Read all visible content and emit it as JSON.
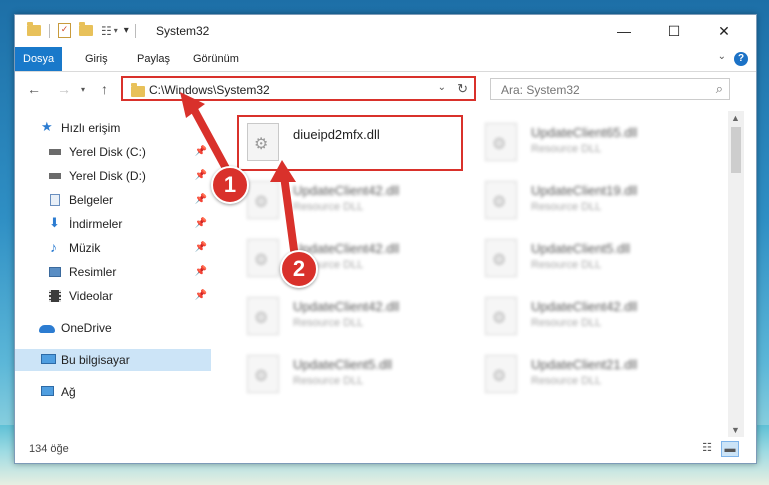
{
  "window": {
    "title": "System32",
    "minimize": "—",
    "maximize": "☐",
    "close": "✕"
  },
  "ribbon": {
    "tabs": [
      "Dosya",
      "Giriş",
      "Paylaş",
      "Görünüm"
    ],
    "help": "?"
  },
  "address": {
    "path": "C:\\Windows\\System32",
    "search_placeholder": "Ara: System32"
  },
  "sidebar": {
    "items": [
      {
        "label": "Hızlı erişim",
        "icon": "star-icon",
        "pinned": false
      },
      {
        "label": "Yerel Disk (C:)",
        "icon": "drive-icon",
        "pinned": true
      },
      {
        "label": "Yerel Disk (D:)",
        "icon": "drive-icon",
        "pinned": true
      },
      {
        "label": "Belgeler",
        "icon": "documents-icon",
        "pinned": true
      },
      {
        "label": "İndirmeler",
        "icon": "downloads-icon",
        "pinned": true
      },
      {
        "label": "Müzik",
        "icon": "music-icon",
        "pinned": true
      },
      {
        "label": "Resimler",
        "icon": "pictures-icon",
        "pinned": true
      },
      {
        "label": "Videolar",
        "icon": "videos-icon",
        "pinned": true
      },
      {
        "label": "OneDrive",
        "icon": "cloud-icon",
        "pinned": false
      },
      {
        "label": "Bu bilgisayar",
        "icon": "computer-icon",
        "pinned": false
      },
      {
        "label": "Ağ",
        "icon": "network-icon",
        "pinned": false
      }
    ]
  },
  "files": [
    {
      "name": "diueipd2mfx.dll",
      "type": ""
    },
    {
      "name": "UpdateClient65.dll",
      "type": "Resource DLL"
    },
    {
      "name": "UpdateClient42.dll",
      "type": "Resource DLL"
    },
    {
      "name": "UpdateClient19.dll",
      "type": "Resource DLL"
    },
    {
      "name": "UpdateClient42.dll",
      "type": "Resource DLL"
    },
    {
      "name": "UpdateClient5.dll",
      "type": "Resource DLL"
    },
    {
      "name": "UpdateClient42.dll",
      "type": "Resource DLL"
    },
    {
      "name": "UpdateClient42.dll",
      "type": "Resource DLL"
    },
    {
      "name": "UpdateClient5.dll",
      "type": "Resource DLL"
    },
    {
      "name": "UpdateClient21.dll",
      "type": "Resource DLL"
    }
  ],
  "status": {
    "count": "134 öğe"
  },
  "annotations": {
    "step1": "1",
    "step2": "2",
    "color": "#d9312b"
  }
}
